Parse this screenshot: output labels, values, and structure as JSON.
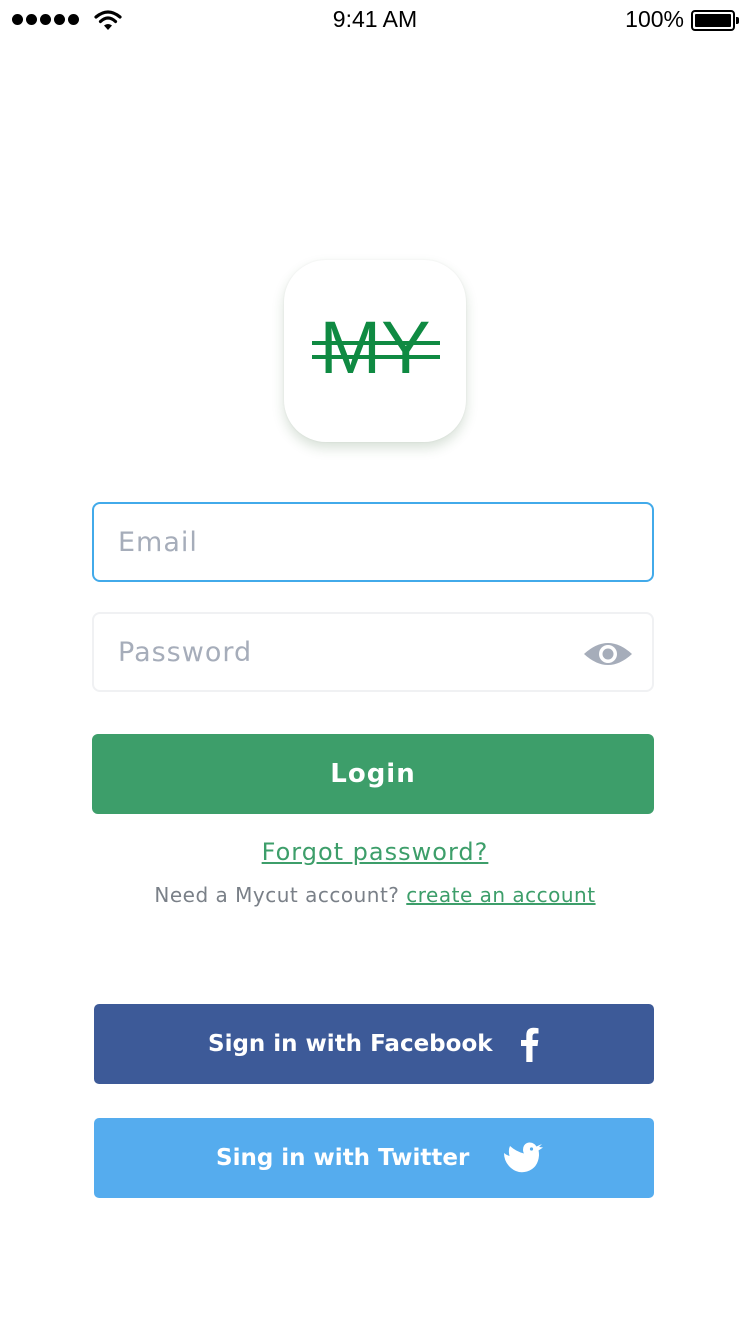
{
  "status_bar": {
    "time": "9:41 AM",
    "battery_percent": "100%",
    "signal_icon": "cellular-signal-icon",
    "wifi_icon": "wifi-icon",
    "battery_icon": "battery-icon"
  },
  "logo": {
    "text": "MY",
    "color": "#0f8a42",
    "icon": "app-logo-icon"
  },
  "email": {
    "placeholder": "Email",
    "value": ""
  },
  "password": {
    "placeholder": "Password",
    "value": "",
    "toggle_icon": "eye-icon"
  },
  "login": {
    "label": "Login"
  },
  "forgot": {
    "label": "Forgot password?"
  },
  "signup": {
    "prompt": "Need a Mycut account? ",
    "link": "create an account"
  },
  "social": {
    "facebook_label": "Sign in with Facebook",
    "twitter_label": "Sing in with Twitter",
    "facebook_icon": "facebook-icon",
    "twitter_icon": "twitter-bird-icon"
  },
  "colors": {
    "accent_green": "#3d9e6a",
    "input_focus": "#42aaea",
    "facebook": "#3d5a98",
    "twitter": "#55acee"
  }
}
